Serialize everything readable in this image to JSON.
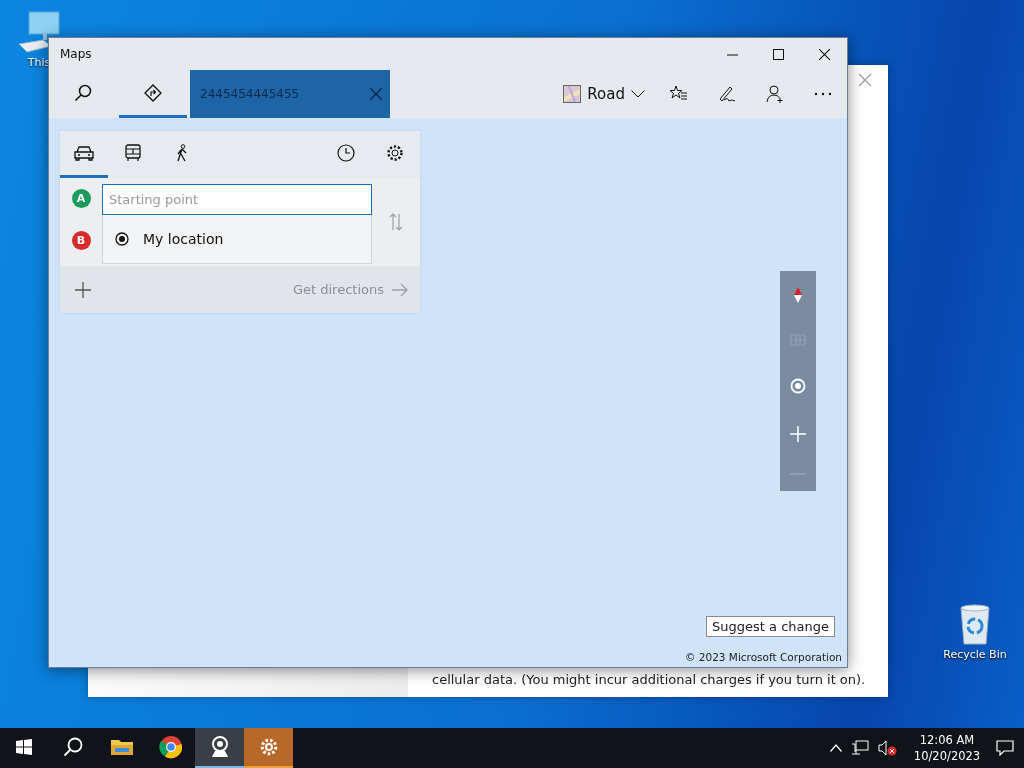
{
  "desktop_icons": [
    {
      "kind": "computer",
      "label": "This"
    },
    {
      "kind": "recycle",
      "label": "Recycle Bin"
    }
  ],
  "background_window": {
    "text": "cellular data. (You might incur additional charges if you turn it on)."
  },
  "window": {
    "title": "Maps"
  },
  "toolbar": {
    "tabs": [
      {
        "kind": "search",
        "selected": false
      },
      {
        "kind": "directions",
        "selected": true
      }
    ],
    "search_box": {
      "value": "2445454445455"
    },
    "map_style": "Road"
  },
  "directions": {
    "modes": [
      {
        "kind": "car",
        "selected": true
      },
      {
        "kind": "bus",
        "selected": false
      },
      {
        "kind": "walk",
        "selected": false
      }
    ],
    "waypoints": [
      {
        "letter": "A",
        "color": "#1a9c5b"
      },
      {
        "letter": "B",
        "color": "#d92b2b"
      }
    ],
    "start_field": {
      "placeholder": "Starting point"
    },
    "suggestions": [
      {
        "label": "My location"
      }
    ],
    "get_directions": "Get directions"
  },
  "map": {
    "suggest_button": "Suggest a change",
    "copyright": "© 2023 Microsoft Corporation"
  },
  "taskbar": {
    "apps": [
      {
        "kind": "search",
        "active": false,
        "attention": false
      },
      {
        "kind": "explorer",
        "active": false,
        "attention": false
      },
      {
        "kind": "chrome",
        "active": false,
        "attention": false
      },
      {
        "kind": "webcam",
        "active": true,
        "attention": false
      },
      {
        "kind": "settings",
        "active": false,
        "attention": true
      }
    ],
    "time": "12:06 AM",
    "date": "10/20/2023"
  }
}
